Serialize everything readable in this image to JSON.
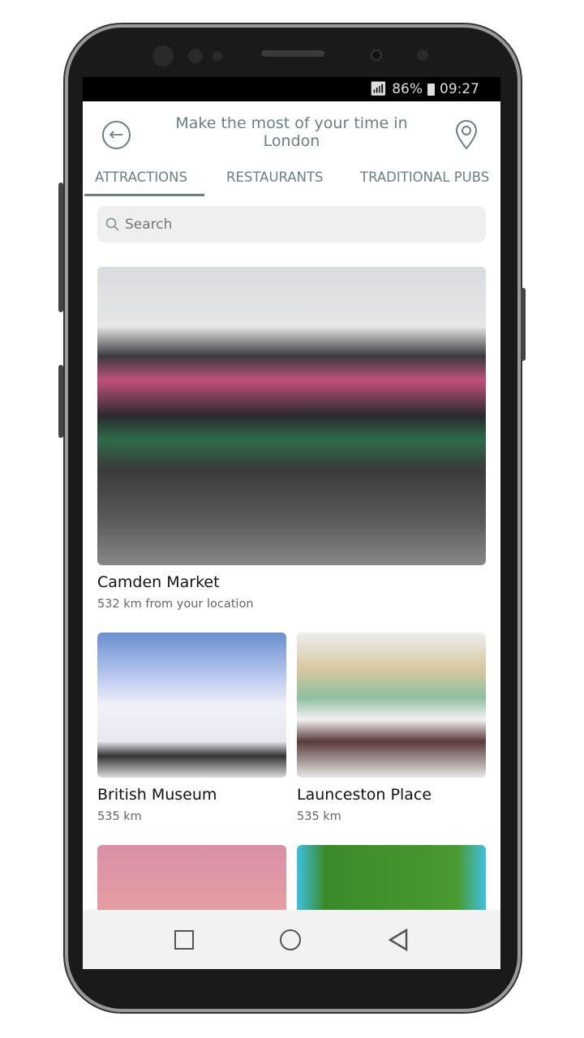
{
  "status_bar": {
    "battery": "86%",
    "time": "09:27",
    "icons": [
      "wifi-icon",
      "signal-icon",
      "battery-icon"
    ]
  },
  "header": {
    "title": "Make the most of your time in London",
    "back_icon": "arrow-left-circle-icon",
    "location_icon": "map-pin-icon"
  },
  "tabs": [
    {
      "label": "ATTRACTIONS",
      "active": true
    },
    {
      "label": "RESTAURANTS"
    },
    {
      "label": "TRADITIONAL PUBS"
    }
  ],
  "search": {
    "placeholder": "Search"
  },
  "places": [
    {
      "name": "Camden Market",
      "distance": "532 km from your location"
    },
    {
      "name": "British Museum",
      "distance": "535 km"
    },
    {
      "name": "Launceston Place",
      "distance": "535 km"
    }
  ],
  "nav": [
    "square-recents-icon",
    "circle-home-icon",
    "triangle-back-icon"
  ],
  "colors": {
    "accent": "#6b7f7f"
  }
}
